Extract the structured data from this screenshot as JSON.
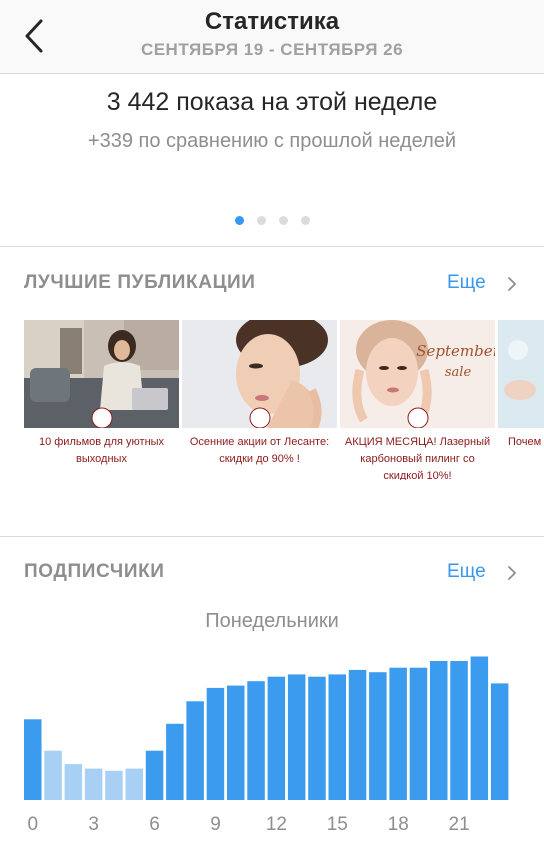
{
  "header": {
    "title": "Статистика",
    "date_range": "СЕНТЯБРЯ 19 - СЕНТЯБРЯ 26"
  },
  "impressions": {
    "main": "3 442 показа на этой неделе",
    "compare": "+339 по сравнению с прошлой неделей",
    "pager_count": 4,
    "pager_active": 0
  },
  "top_posts": {
    "title": "ЛУЧШИЕ ПУБЛИКАЦИИ",
    "more": "Еще",
    "items": [
      {
        "caption": "10 фильмов для уютных выходных"
      },
      {
        "caption": "Осенние акции от Лесанте: скидки до 90% !"
      },
      {
        "caption": "АКЦИЯ МЕСЯЦА! Лазерный карбоновый пилинг со скидкой 10%!",
        "overlay": "September sale"
      },
      {
        "caption": "Почем"
      }
    ]
  },
  "followers": {
    "title": "ПОДПИСЧИКИ",
    "more": "Еще",
    "chart_title": "Понедельники"
  },
  "colors": {
    "accent": "#3897f0",
    "bar_light": "#a8d0f5",
    "bar_dark": "#3a9bef",
    "caption": "#8b1a1a"
  },
  "chart_data": {
    "type": "bar",
    "title": "Понедельники",
    "x": [
      0,
      1,
      2,
      3,
      4,
      5,
      6,
      7,
      8,
      9,
      10,
      11,
      12,
      13,
      14,
      15,
      16,
      17,
      18,
      19,
      20,
      21,
      22,
      23
    ],
    "xticks": [
      "0",
      "3",
      "6",
      "9",
      "12",
      "15",
      "18",
      "21"
    ],
    "values": [
      18,
      11,
      8,
      7,
      6.5,
      7,
      11,
      17,
      22,
      25,
      25.5,
      26.5,
      27.5,
      28,
      27.5,
      28,
      29,
      28.5,
      29.5,
      29.5,
      31,
      31,
      32,
      26
    ],
    "ylim": [
      0,
      33
    ],
    "yticks_shown": false,
    "grid": false
  }
}
